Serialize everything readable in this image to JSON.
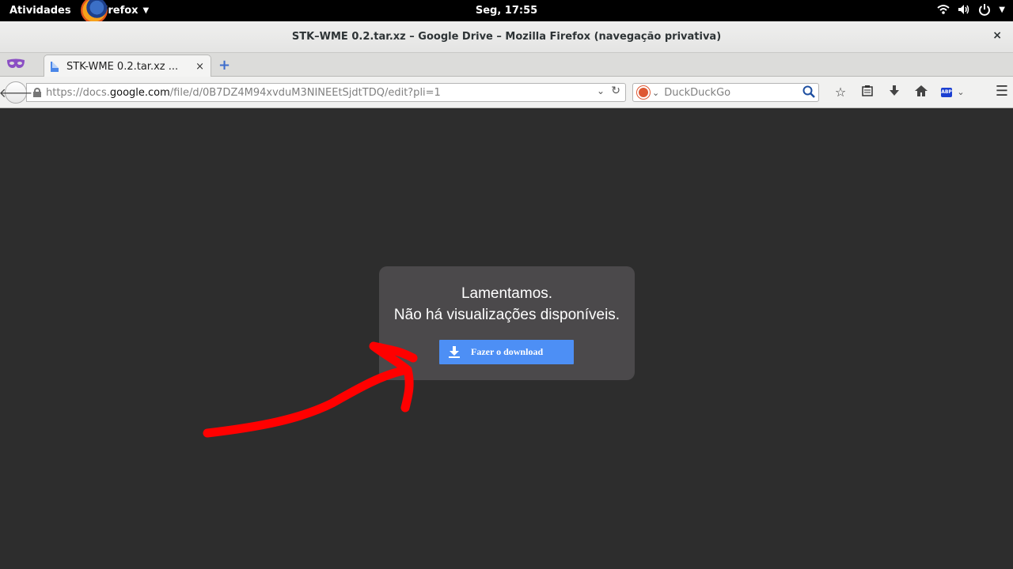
{
  "topbar": {
    "activities": "Atividades",
    "app_name": "Firefox",
    "clock": "Seg, 17:55",
    "icons": [
      "wifi-icon",
      "volume-icon",
      "power-icon"
    ]
  },
  "window": {
    "title": "STK–WME 0.2.tar.xz – Google Drive – Mozilla Firefox (navegação privativa)",
    "close_label": "×"
  },
  "tabs": [
    {
      "label": "STK-WME 0.2.tar.xz ...",
      "close_label": "×"
    }
  ],
  "newtab_label": "+",
  "urlbar": {
    "url_prefix": "https://docs.",
    "url_host": "google.com",
    "url_path": "/file/d/0B7DZ4M94xvduM3NINEEtSjdtTDQ/edit?pli=1"
  },
  "searchbar": {
    "placeholder": "DuckDuckGo"
  },
  "toolbar": {
    "abp_label": "ABP"
  },
  "dialog": {
    "line1": "Lamentamos.",
    "line2": "Não há visualizações disponíveis.",
    "download_label": "Fazer o download"
  },
  "colors": {
    "content_bg": "#2d2d2d",
    "dialog_bg": "#4b494b",
    "button_blue": "#4d8ff5",
    "annotation_red": "#ff0000"
  }
}
